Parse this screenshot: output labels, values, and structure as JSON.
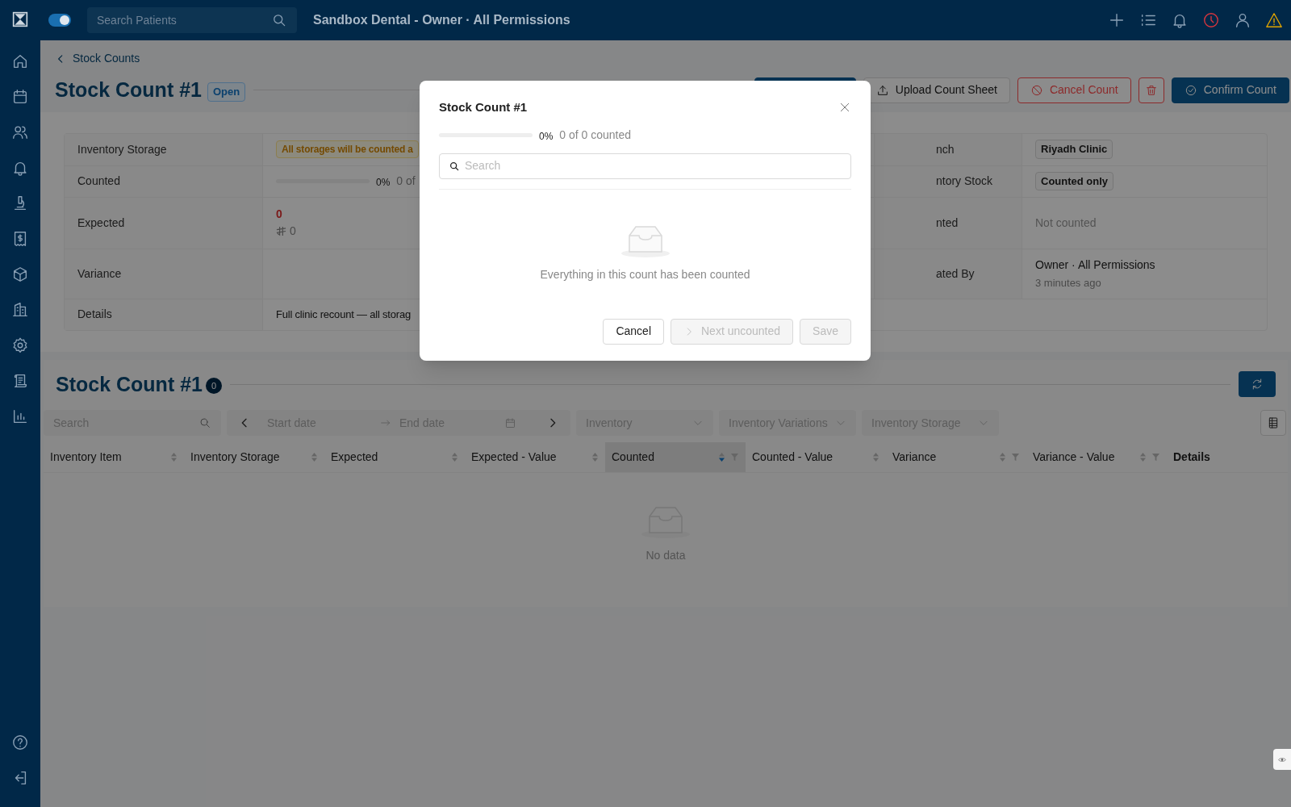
{
  "topbar": {
    "toggle_on": true,
    "search_placeholder": "Search Patients",
    "title": "Sandbox Dental - Owner · All Permissions"
  },
  "breadcrumb": "Stock Counts",
  "header": {
    "title": "Stock Count #1",
    "status": "Open",
    "buttons": [
      {
        "kind": "blank"
      },
      {
        "kind": "upload",
        "label": "Upload Count Sheet"
      },
      {
        "kind": "danger",
        "label": "Cancel Count"
      },
      {
        "kind": "delete"
      },
      {
        "kind": "primary",
        "label": "Confirm Count"
      }
    ]
  },
  "details": [
    {
      "label": "Inventory Storage",
      "value": {
        "kind": "warning",
        "text": "All storages will be counted a"
      },
      "label_2": "nch",
      "value_2": {
        "kind": "tag",
        "text": "Riyadh Clinic"
      }
    },
    {
      "label": "Counted",
      "value": {
        "kind": "progress",
        "level": 0,
        "percent": "0%",
        "text": "0 of"
      },
      "label_2": "ntory Stock",
      "value_2": {
        "kind": "tag",
        "text": "Counted only"
      }
    },
    {
      "label": "Expected",
      "value": {
        "kind": "money",
        "text": "0",
        "amount": "0"
      },
      "label_2": "nted",
      "value_2": {
        "kind": "muted",
        "text": "Not counted"
      }
    },
    {
      "label": "Variance",
      "label_2": "ated By",
      "value_2": {
        "kind": "user",
        "text": "Owner · All Permissions",
        "sub": "3 minutes ago"
      }
    },
    {
      "label": "Details",
      "value": {
        "kind": "text",
        "text": "Full clinic recount — all storag"
      }
    }
  ],
  "table_section": {
    "title": "Stock Count #1",
    "count": "0",
    "search_placeholder": "Search",
    "start_placeholder": "Start date",
    "end_placeholder": "End date",
    "filters": [
      "Inventory",
      "Inventory Variations",
      "Inventory Storage"
    ],
    "columns": [
      {
        "label": "Inventory Item",
        "sortable": true,
        "sorted_descending": false,
        "filter": false,
        "selected": false
      },
      {
        "label": "Inventory Storage",
        "sortable": true,
        "sorted_descending": false,
        "filter": false,
        "selected": false
      },
      {
        "label": "Expected",
        "sortable": true,
        "sorted_descending": false,
        "filter": false,
        "selected": false
      },
      {
        "label": "Expected - Value",
        "sortable": true,
        "sorted_descending": false,
        "filter": false,
        "selected": false
      },
      {
        "label": "Counted",
        "sortable": true,
        "sorted_descending": true,
        "filter": true,
        "selected": true
      },
      {
        "label": "Counted - Value",
        "sortable": true,
        "sorted_descending": false,
        "filter": false,
        "selected": false
      },
      {
        "label": "Variance",
        "sortable": true,
        "sorted_descending": false,
        "filter": true,
        "selected": false
      },
      {
        "label": "Variance - Value",
        "sortable": true,
        "sorted_descending": false,
        "filter": true,
        "selected": false
      },
      {
        "label": "Details",
        "sortable": false,
        "filter": false,
        "selected": false
      }
    ],
    "empty": "No data"
  },
  "modal": {
    "title": "Stock Count #1",
    "level": 0,
    "percent": "0%",
    "progress_text": "0 of 0 counted",
    "search_placeholder": "Search",
    "message": "Everything in this count has been counted",
    "buttons": [
      {
        "kind": "plain",
        "label": "Cancel",
        "disabled": false
      },
      {
        "kind": "next",
        "label": "Next uncounted",
        "disabled": true
      },
      {
        "kind": "plain",
        "label": "Save",
        "disabled": true
      }
    ]
  }
}
